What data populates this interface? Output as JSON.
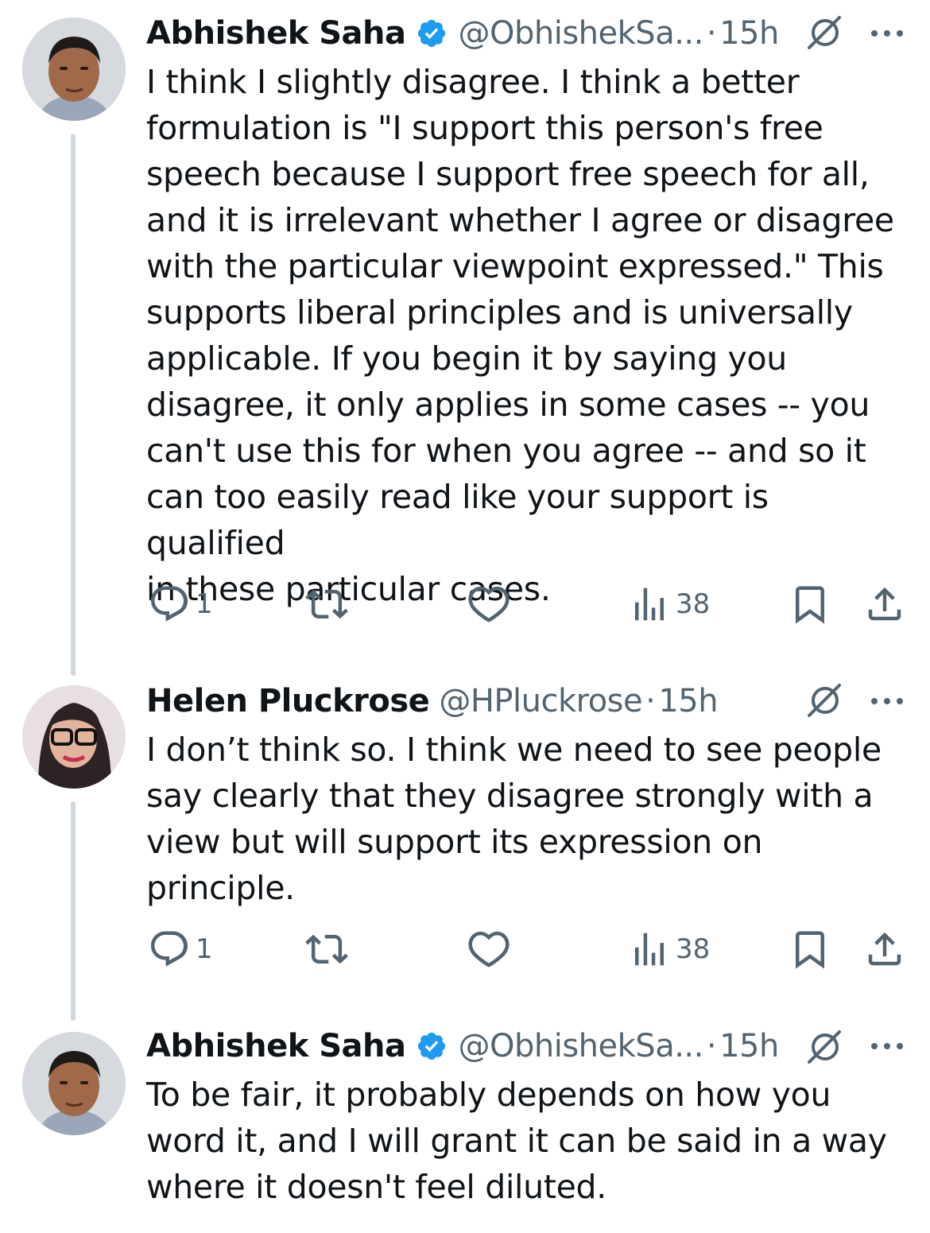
{
  "tweets": [
    {
      "name": "Abhishek Saha",
      "verified": true,
      "handle": "@ObhishekSa...",
      "time": "15h",
      "text": "I think I slightly disagree. I think a better\nformulation is \"I support this person's free\nspeech because I support free speech for all,\nand it is irrelevant whether I agree or disagree\nwith the particular viewpoint expressed.\" This\nsupports liberal principles and is universally\napplicable. If you begin it by saying you\ndisagree, it only applies in some cases -- you\ncan't use this for when you agree -- and so it\ncan too easily read like your support is qualified\nin these particular cases.",
      "reply_count": "1",
      "retweet_count": "",
      "like_count": "",
      "view_count": "38"
    },
    {
      "name": "Helen Pluckrose",
      "verified": false,
      "handle": "@HPluckrose",
      "time": "15h",
      "text": "I don’t think so. I think we need to see people\nsay clearly that they disagree strongly with a\nview but will support its expression on\nprinciple.",
      "reply_count": "1",
      "retweet_count": "",
      "like_count": "",
      "view_count": "38"
    },
    {
      "name": "Abhishek Saha",
      "verified": true,
      "handle": "@ObhishekSa...",
      "time": "15h",
      "text": "To be fair, it probably depends on how you\nword it, and I will grant it can be said in a way\nwhere it doesn't feel diluted."
    }
  ],
  "separator": "·",
  "colors": {
    "text": "#0f1419",
    "secondary": "#536471",
    "verified": "#1d9bf0",
    "thread_line": "#cfd9de"
  },
  "icons": [
    "verified-badge-icon",
    "grok-icon",
    "more-icon",
    "reply-icon",
    "retweet-icon",
    "like-icon",
    "views-icon",
    "bookmark-icon",
    "share-icon"
  ]
}
